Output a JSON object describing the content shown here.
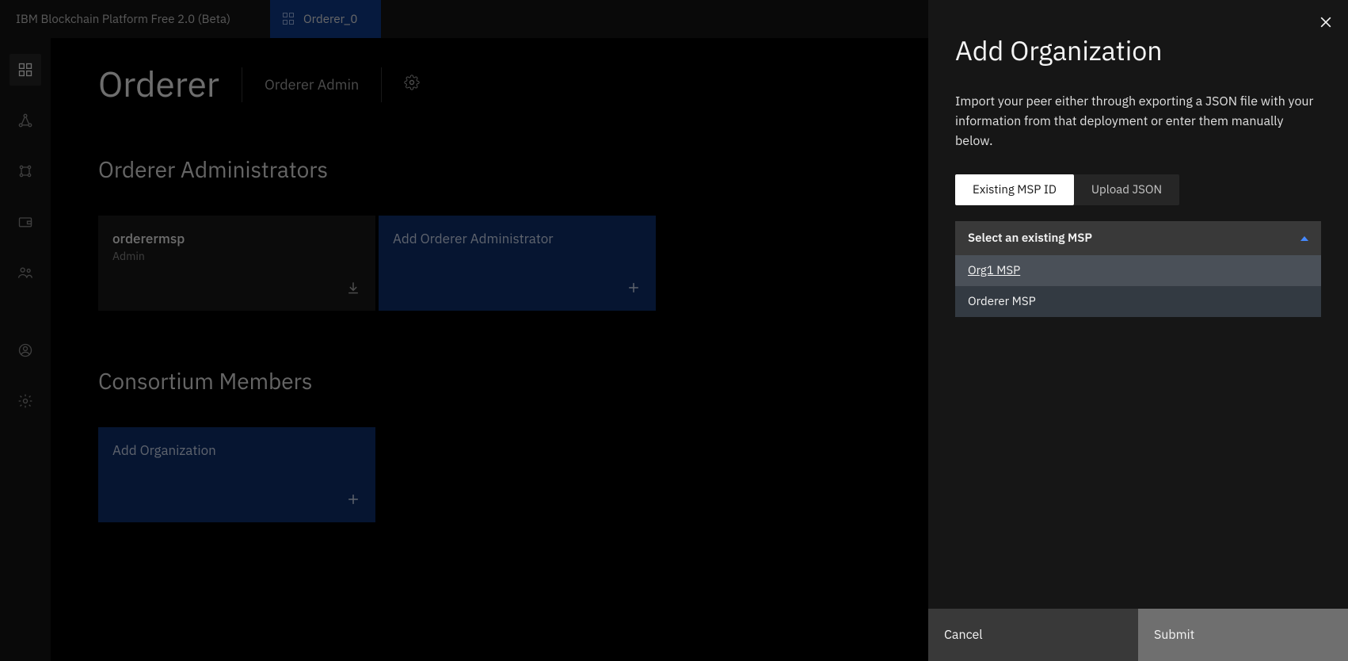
{
  "app": {
    "title": "IBM Blockchain Platform Free 2.0 (Beta)",
    "tab": {
      "label": "Orderer_0"
    }
  },
  "page": {
    "title": "Orderer",
    "subtitle": "Orderer Admin"
  },
  "sections": {
    "admins": {
      "title": "Orderer Administrators",
      "tile": {
        "title": "orderermsp",
        "subtitle": "Admin"
      },
      "add": {
        "label": "Add Orderer Administrator"
      }
    },
    "consortium": {
      "title": "Consortium Members",
      "add": {
        "label": "Add Organization"
      }
    }
  },
  "panel": {
    "title": "Add Organization",
    "description": "Import your peer either through exporting a JSON file with your information from that deployment or enter them manually below.",
    "tabs": {
      "existing": "Existing MSP ID",
      "upload": "Upload JSON"
    },
    "dropdown": {
      "label": "Select an existing MSP",
      "options": [
        "Org1 MSP",
        "Orderer MSP"
      ]
    },
    "footer": {
      "cancel": "Cancel",
      "submit": "Submit"
    }
  }
}
